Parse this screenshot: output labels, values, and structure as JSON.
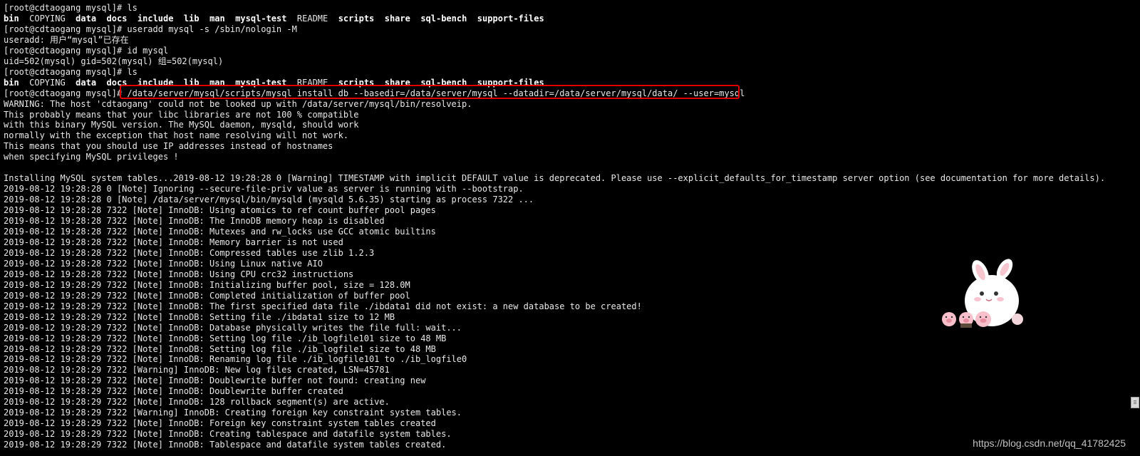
{
  "terminal": {
    "lines": [
      [
        {
          "t": "[root@cdtaogang mysql]# ls",
          "b": false
        }
      ],
      [
        {
          "t": "bin",
          "b": true
        },
        {
          "t": "  COPYING  ",
          "b": false
        },
        {
          "t": "data",
          "b": true
        },
        {
          "t": "  ",
          "b": false
        },
        {
          "t": "docs",
          "b": true
        },
        {
          "t": "  ",
          "b": false
        },
        {
          "t": "include",
          "b": true
        },
        {
          "t": "  ",
          "b": false
        },
        {
          "t": "lib",
          "b": true
        },
        {
          "t": "  ",
          "b": false
        },
        {
          "t": "man",
          "b": true
        },
        {
          "t": "  ",
          "b": false
        },
        {
          "t": "mysql-test",
          "b": true
        },
        {
          "t": "  README  ",
          "b": false
        },
        {
          "t": "scripts",
          "b": true
        },
        {
          "t": "  ",
          "b": false
        },
        {
          "t": "share",
          "b": true
        },
        {
          "t": "  ",
          "b": false
        },
        {
          "t": "sql-bench",
          "b": true
        },
        {
          "t": "  ",
          "b": false
        },
        {
          "t": "support-files",
          "b": true
        }
      ],
      [
        {
          "t": "[root@cdtaogang mysql]# useradd mysql -s /sbin/nologin -M",
          "b": false
        }
      ],
      [
        {
          "t": "useradd: 用户“mysql”已存在",
          "b": false
        }
      ],
      [
        {
          "t": "[root@cdtaogang mysql]# id mysql",
          "b": false
        }
      ],
      [
        {
          "t": "uid=502(mysql) gid=502(mysql) 组=502(mysql)",
          "b": false
        }
      ],
      [
        {
          "t": "[root@cdtaogang mysql]# ls",
          "b": false
        }
      ],
      [
        {
          "t": "bin",
          "b": true
        },
        {
          "t": "  COPYING  ",
          "b": false
        },
        {
          "t": "data",
          "b": true
        },
        {
          "t": "  ",
          "b": false
        },
        {
          "t": "docs",
          "b": true
        },
        {
          "t": "  ",
          "b": false
        },
        {
          "t": "include",
          "b": true
        },
        {
          "t": "  ",
          "b": false
        },
        {
          "t": "lib",
          "b": true
        },
        {
          "t": "  ",
          "b": false
        },
        {
          "t": "man",
          "b": true
        },
        {
          "t": "  ",
          "b": false
        },
        {
          "t": "mysql-test",
          "b": true
        },
        {
          "t": "  README  ",
          "b": false
        },
        {
          "t": "scripts",
          "b": true
        },
        {
          "t": "  ",
          "b": false
        },
        {
          "t": "share",
          "b": true
        },
        {
          "t": "  ",
          "b": false
        },
        {
          "t": "sql-bench",
          "b": true
        },
        {
          "t": "  ",
          "b": false
        },
        {
          "t": "support-files",
          "b": true
        }
      ],
      [
        {
          "t": "[root@cdtaogang mysql]# /data/server/mysql/scripts/mysql_install_db --basedir=/data/server/mysql --datadir=/data/server/mysql/data/ --user=mysql",
          "b": false
        }
      ],
      [
        {
          "t": "WARNING: The host 'cdtaogang' could not be looked up with /data/server/mysql/bin/resolveip.",
          "b": false
        }
      ],
      [
        {
          "t": "This probably means that your libc libraries are not 100 % compatible",
          "b": false
        }
      ],
      [
        {
          "t": "with this binary MySQL version. The MySQL daemon, mysqld, should work",
          "b": false
        }
      ],
      [
        {
          "t": "normally with the exception that host name resolving will not work.",
          "b": false
        }
      ],
      [
        {
          "t": "This means that you should use IP addresses instead of hostnames",
          "b": false
        }
      ],
      [
        {
          "t": "when specifying MySQL privileges !",
          "b": false
        }
      ],
      [
        {
          "t": "",
          "b": false
        }
      ],
      [
        {
          "t": "Installing MySQL system tables...2019-08-12 19:28:28 0 [Warning] TIMESTAMP with implicit DEFAULT value is deprecated. Please use --explicit_defaults_for_timestamp server option (see documentation for more details).",
          "b": false
        }
      ],
      [
        {
          "t": "2019-08-12 19:28:28 0 [Note] Ignoring --secure-file-priv value as server is running with --bootstrap.",
          "b": false
        }
      ],
      [
        {
          "t": "2019-08-12 19:28:28 0 [Note] /data/server/mysql/bin/mysqld (mysqld 5.6.35) starting as process 7322 ...",
          "b": false
        }
      ],
      [
        {
          "t": "2019-08-12 19:28:28 7322 [Note] InnoDB: Using atomics to ref count buffer pool pages",
          "b": false
        }
      ],
      [
        {
          "t": "2019-08-12 19:28:28 7322 [Note] InnoDB: The InnoDB memory heap is disabled",
          "b": false
        }
      ],
      [
        {
          "t": "2019-08-12 19:28:28 7322 [Note] InnoDB: Mutexes and rw_locks use GCC atomic builtins",
          "b": false
        }
      ],
      [
        {
          "t": "2019-08-12 19:28:28 7322 [Note] InnoDB: Memory barrier is not used",
          "b": false
        }
      ],
      [
        {
          "t": "2019-08-12 19:28:28 7322 [Note] InnoDB: Compressed tables use zlib 1.2.3",
          "b": false
        }
      ],
      [
        {
          "t": "2019-08-12 19:28:28 7322 [Note] InnoDB: Using Linux native AIO",
          "b": false
        }
      ],
      [
        {
          "t": "2019-08-12 19:28:28 7322 [Note] InnoDB: Using CPU crc32 instructions",
          "b": false
        }
      ],
      [
        {
          "t": "2019-08-12 19:28:29 7322 [Note] InnoDB: Initializing buffer pool, size = 128.0M",
          "b": false
        }
      ],
      [
        {
          "t": "2019-08-12 19:28:29 7322 [Note] InnoDB: Completed initialization of buffer pool",
          "b": false
        }
      ],
      [
        {
          "t": "2019-08-12 19:28:29 7322 [Note] InnoDB: The first specified data file ./ibdata1 did not exist: a new database to be created!",
          "b": false
        }
      ],
      [
        {
          "t": "2019-08-12 19:28:29 7322 [Note] InnoDB: Setting file ./ibdata1 size to 12 MB",
          "b": false
        }
      ],
      [
        {
          "t": "2019-08-12 19:28:29 7322 [Note] InnoDB: Database physically writes the file full: wait...",
          "b": false
        }
      ],
      [
        {
          "t": "2019-08-12 19:28:29 7322 [Note] InnoDB: Setting log file ./ib_logfile101 size to 48 MB",
          "b": false
        }
      ],
      [
        {
          "t": "2019-08-12 19:28:29 7322 [Note] InnoDB: Setting log file ./ib_logfile1 size to 48 MB",
          "b": false
        }
      ],
      [
        {
          "t": "2019-08-12 19:28:29 7322 [Note] InnoDB: Renaming log file ./ib_logfile101 to ./ib_logfile0",
          "b": false
        }
      ],
      [
        {
          "t": "2019-08-12 19:28:29 7322 [Warning] InnoDB: New log files created, LSN=45781",
          "b": false
        }
      ],
      [
        {
          "t": "2019-08-12 19:28:29 7322 [Note] InnoDB: Doublewrite buffer not found: creating new",
          "b": false
        }
      ],
      [
        {
          "t": "2019-08-12 19:28:29 7322 [Note] InnoDB: Doublewrite buffer created",
          "b": false
        }
      ],
      [
        {
          "t": "2019-08-12 19:28:29 7322 [Note] InnoDB: 128 rollback segment(s) are active.",
          "b": false
        }
      ],
      [
        {
          "t": "2019-08-12 19:28:29 7322 [Warning] InnoDB: Creating foreign key constraint system tables.",
          "b": false
        }
      ],
      [
        {
          "t": "2019-08-12 19:28:29 7322 [Note] InnoDB: Foreign key constraint system tables created",
          "b": false
        }
      ],
      [
        {
          "t": "2019-08-12 19:28:29 7322 [Note] InnoDB: Creating tablespace and datafile system tables.",
          "b": false
        }
      ],
      [
        {
          "t": "2019-08-12 19:28:29 7322 [Note] InnoDB: Tablespace and datafile system tables created.",
          "b": false
        }
      ]
    ]
  },
  "watermark": "https://blog.csdn.net/qq_41782425",
  "colors": {
    "background": "#000000",
    "text": "#e8e8e8",
    "highlight": "#e00000"
  },
  "icons": {
    "sticker": "bunny-with-piglets-sticker"
  }
}
